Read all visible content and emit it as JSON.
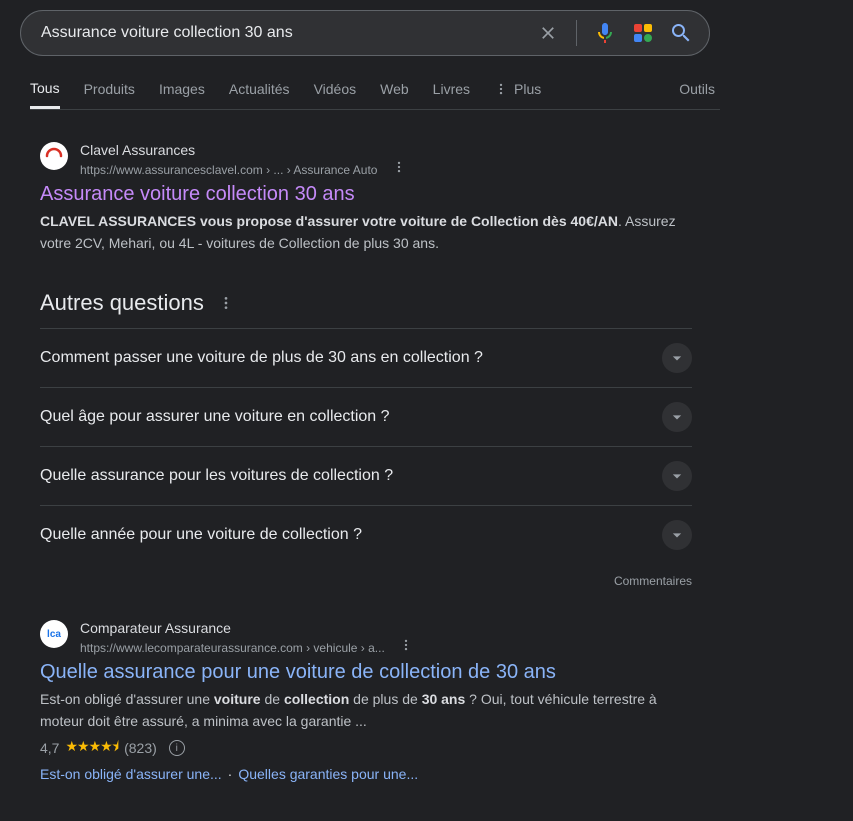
{
  "search": {
    "query": "Assurance voiture collection 30 ans"
  },
  "tabs": {
    "items": [
      "Tous",
      "Produits",
      "Images",
      "Actualités",
      "Vidéos",
      "Web",
      "Livres"
    ],
    "more": "Plus",
    "tools": "Outils",
    "active": 0
  },
  "results": [
    {
      "site_name": "Clavel Assurances",
      "url": "https://www.assurancesclavel.com › ... › Assurance Auto",
      "title": "Assurance voiture collection 30 ans",
      "visited": true,
      "snippet_bold": "CLAVEL ASSURANCES vous propose d'assurer votre voiture de Collection dès 40€/AN",
      "snippet_rest": ". Assurez votre 2CV, Mehari, ou 4L - voitures de Collection de plus 30 ans."
    },
    {
      "site_name": "Comparateur Assurance",
      "url": "https://www.lecomparateurassurance.com › vehicule › a...",
      "title": "Quelle assurance pour une voiture de collection de 30 ans",
      "visited": false,
      "snippet_html_pre": "Est-on obligé d'assurer une ",
      "snippet_b1": "voiture",
      "snippet_mid1": " de ",
      "snippet_b2": "collection",
      "snippet_mid2": " de plus de ",
      "snippet_b3": "30 ans",
      "snippet_post": " ? Oui, tout véhicule terrestre à moteur doit être assuré, a minima avec la garantie ...",
      "rating": "4,7",
      "stars": "★★★★⯨",
      "votes": "(823)",
      "sublinks": [
        "Est-on obligé d'assurer une...",
        "Quelles garanties pour une..."
      ]
    }
  ],
  "paa": {
    "title": "Autres questions",
    "questions": [
      "Comment passer une voiture de plus de 30 ans en collection ?",
      "Quel âge pour assurer une voiture en collection ?",
      "Quelle assurance pour les voitures de collection ?",
      "Quelle année pour une voiture de collection ?"
    ],
    "feedback": "Commentaires"
  }
}
